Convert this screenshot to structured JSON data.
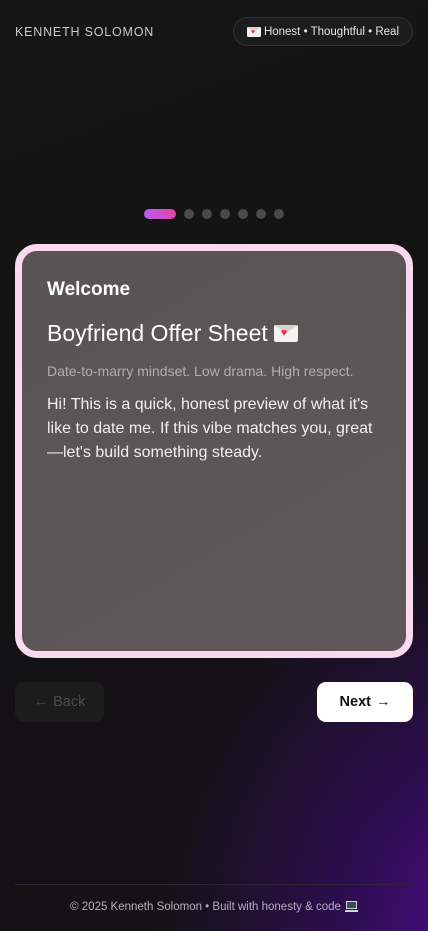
{
  "header": {
    "brand": "KENNETH SOLOMON",
    "tagline_icon": "love-letter-icon",
    "tagline": "Honest • Thoughtful • Real"
  },
  "progress": {
    "current_step": 1,
    "total_steps": 7
  },
  "card": {
    "label": "Welcome",
    "title": "Boyfriend Offer Sheet",
    "title_icon": "love-letter-icon",
    "subtitle": "Date-to-marry mindset. Low drama. High respect.",
    "body": "Hi! This is a quick, honest preview of what it's like to date me. If this vibe matches you, great—let's build something steady."
  },
  "nav": {
    "back_label": "Back",
    "back_icon": "arrow-left-icon",
    "next_label": "Next",
    "next_icon": "arrow-right-icon"
  },
  "footer": {
    "text": "© 2025 Kenneth Solomon • Built with honesty & code",
    "icon": "laptop-icon"
  },
  "colors": {
    "card_border": "#f9d9ee",
    "card_background": "#5a5456",
    "progress_active_start": "#b65cf0",
    "progress_active_end": "#e045a8",
    "progress_inactive": "#4a4a4a",
    "background_glow": "#4c0c8c"
  }
}
